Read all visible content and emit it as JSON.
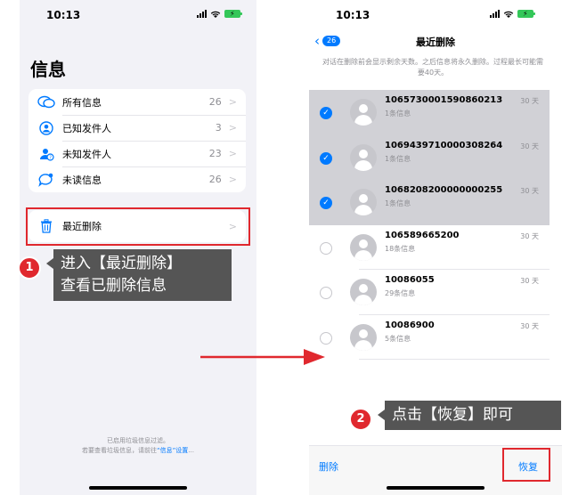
{
  "left_phone": {
    "time": "10:13",
    "title": "信息",
    "filters": [
      {
        "label": "所有信息",
        "count": "26",
        "icon": "all-messages-icon"
      },
      {
        "label": "已知发件人",
        "count": "3",
        "icon": "known-sender-icon"
      },
      {
        "label": "未知发件人",
        "count": "23",
        "icon": "unknown-sender-icon"
      },
      {
        "label": "未读信息",
        "count": "26",
        "icon": "unread-icon"
      }
    ],
    "recently_deleted": {
      "label": "最近删除",
      "icon": "trash-icon"
    },
    "footer_line1": "已启用垃圾信息过滤。",
    "footer_line2_pre": "若要查看垃圾信息，请前往",
    "footer_link": "“信息”设置",
    "footer_line2_post": "..."
  },
  "right_phone": {
    "time": "10:13",
    "back_count": "26",
    "nav_title": "最近删除",
    "note": "对话在删除前会显示剩余天数。之后信息将永久删除。过程最长可能需要40天。",
    "messages": [
      {
        "sender": "1065730001590860213",
        "count": "1条信息",
        "days": "30 天",
        "selected": true
      },
      {
        "sender": "1069439710000308264",
        "count": "1条信息",
        "days": "30 天",
        "selected": true
      },
      {
        "sender": "1068208200000000255",
        "count": "1条信息",
        "days": "30 天",
        "selected": true
      },
      {
        "sender": "106589665200",
        "count": "18条信息",
        "days": "30 天",
        "selected": false
      },
      {
        "sender": "10086055",
        "count": "29条信息",
        "days": "30 天",
        "selected": false
      },
      {
        "sender": "10086900",
        "count": "5条信息",
        "days": "30 天",
        "selected": false
      }
    ],
    "toolbar": {
      "delete": "删除",
      "recover": "恢复"
    }
  },
  "annotations": {
    "step1_num": "1",
    "step1_line1": "进入【最近删除】",
    "step1_line2": "查看已删除信息",
    "step2_num": "2",
    "step2_text": "点击【恢复】即可"
  },
  "colors": {
    "accent": "#007aff",
    "highlight": "#e0282e",
    "callout": "#555555",
    "selected_row": "#d1d1d6"
  }
}
